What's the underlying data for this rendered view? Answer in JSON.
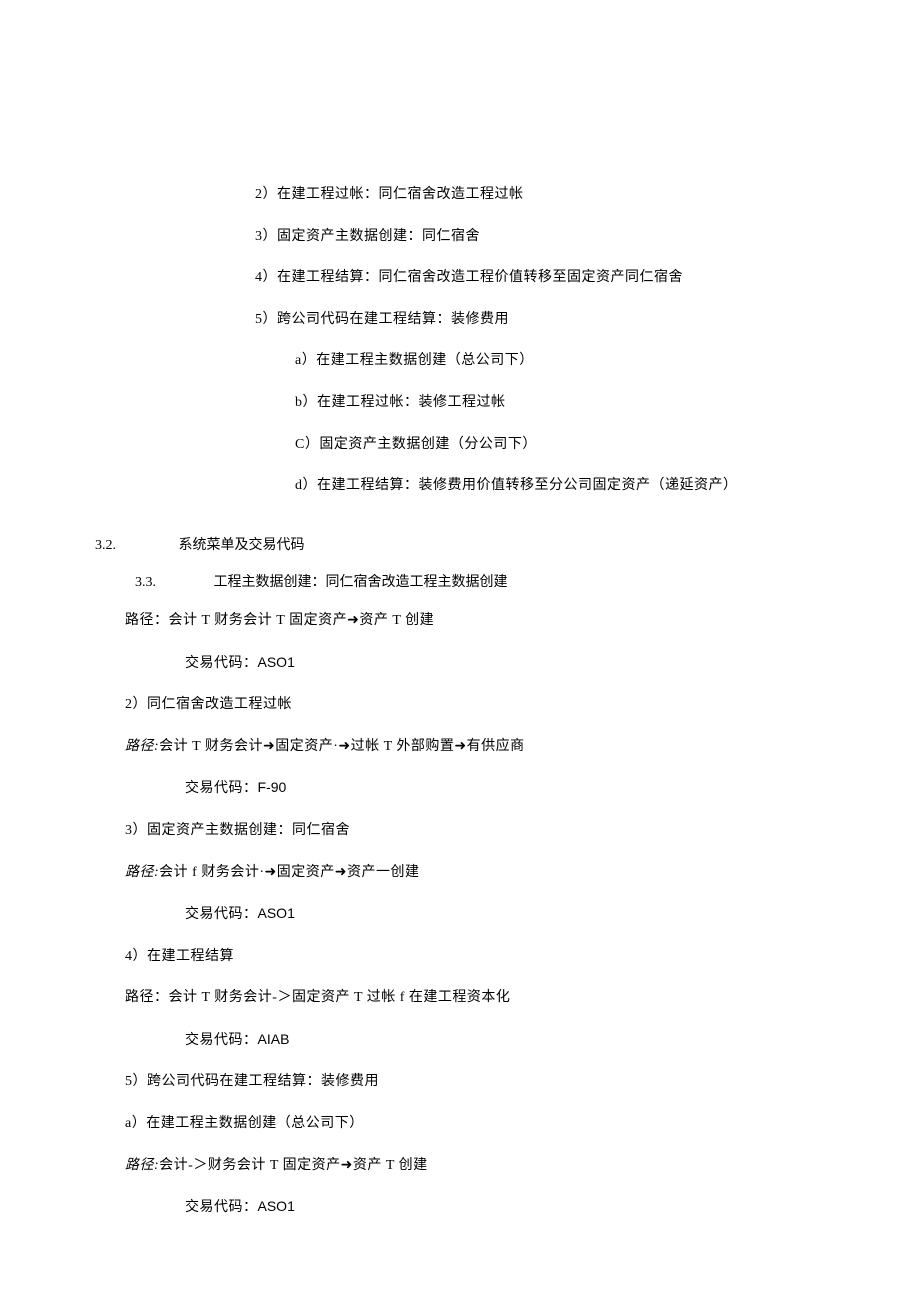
{
  "topList": {
    "item2": "2）在建工程过帐：同仁宿舍改造工程过帐",
    "item3": "3）固定资产主数据创建：同仁宿舍",
    "item4": "4）在建工程结算：同仁宿舍改造工程价值转移至固定资产同仁宿舍",
    "item5": "5）跨公司代码在建工程结算：装修费用",
    "sub_a": "a）在建工程主数据创建（总公司下）",
    "sub_b": "b）在建工程过帐：装修工程过帐",
    "sub_c": "C）固定资产主数据创建（分公司下）",
    "sub_d": "d）在建工程结算：装修费用价值转移至分公司固定资产（递延资产）"
  },
  "section32": {
    "num": "3.2.",
    "title": "系统菜单及交易代码"
  },
  "section33": {
    "num": "3.3.",
    "title": "工程主数据创建：同仁宿舍改造工程主数据创建",
    "path_label": "路径：",
    "path_text": "会计 T 财务会计 T 固定资产➜资产 T 创建",
    "code_label": "交易代码：",
    "code": "ASO1"
  },
  "step2": {
    "heading": "2）同仁宿舍改造工程过帐",
    "path_label": "路径:",
    "path_text": "会计 T 财务会计➜固定资产·➜过帐 T 外部购置➜有供应商",
    "code_label": "交易代码：",
    "code": "F-90"
  },
  "step3": {
    "heading": "3）固定资产主数据创建：同仁宿舍",
    "path_label": "路径:",
    "path_text": "会计 f 财务会计·➜固定资产➜资产一创建",
    "code_label": "交易代码：",
    "code": "ASO1"
  },
  "step4": {
    "heading": "4）在建工程结算",
    "path_label": "路径：",
    "path_text": "会计 T 财务会计-＞固定资产 T 过帐 f 在建工程资本化",
    "code_label": "交易代码：",
    "code": "AIAB"
  },
  "step5": {
    "heading": "5）跨公司代码在建工程结算：装修费用",
    "sub_a": "a）在建工程主数据创建（总公司下）",
    "path_label": "路径:",
    "path_text": "会计-＞财务会计 T 固定资产➜资产 T 创建",
    "code_label": "交易代码：",
    "code": "ASO1"
  }
}
